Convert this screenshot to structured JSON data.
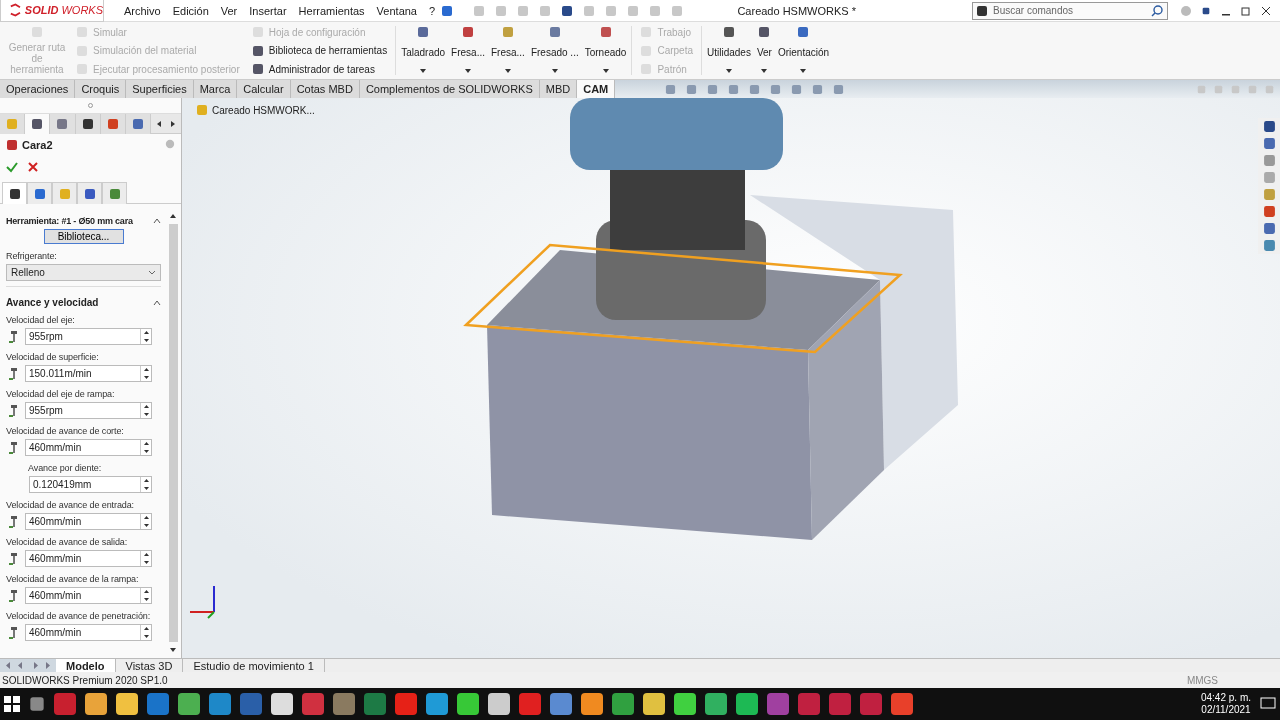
{
  "app": {
    "logo_bold": "SOLID",
    "logo_light": "WORKS",
    "menus": [
      "Archivo",
      "Edición",
      "Ver",
      "Insertar",
      "Herramientas",
      "Ventana",
      "?"
    ],
    "title": "Careado HSMWORKS *",
    "search": {
      "placeholder": "Buscar comandos"
    }
  },
  "ribbon": {
    "generate": {
      "label": "Generar ruta de herramienta",
      "disabled": true
    },
    "column_1": [
      {
        "label": "Simular",
        "disabled": true
      },
      {
        "label": "Simulación del material",
        "disabled": true
      },
      {
        "label": "Ejecutar procesamiento posterior",
        "disabled": true
      }
    ],
    "column_2": [
      {
        "label": "Hoja de configuración",
        "disabled": true
      },
      {
        "label": "Biblioteca de herramientas",
        "disabled": false
      },
      {
        "label": "Administrador de tareas",
        "disabled": false
      }
    ],
    "operations": [
      "Taladrado",
      "Fresa...",
      "Fresa...",
      "Fresado ...",
      "Torneado"
    ],
    "column_3": [
      {
        "label": "Trabajo",
        "disabled": true
      },
      {
        "label": "Carpeta",
        "disabled": true
      },
      {
        "label": "Patrón",
        "disabled": true
      }
    ],
    "utilities": [
      "Utilidades",
      "Ver",
      "Orientación"
    ]
  },
  "command_tabs": [
    {
      "label": "Operaciones",
      "selected": false
    },
    {
      "label": "Croquis",
      "selected": false
    },
    {
      "label": "Superficies",
      "selected": false
    },
    {
      "label": "Marca",
      "selected": false
    },
    {
      "label": "Calcular",
      "selected": false
    },
    {
      "label": "Cotas MBD",
      "selected": false
    },
    {
      "label": "Complementos de SOLIDWORKS",
      "selected": false
    },
    {
      "label": "MBD",
      "selected": false
    },
    {
      "label": "CAM",
      "selected": true
    }
  ],
  "manager_tabs": [
    {
      "selected": false
    },
    {
      "selected": true
    },
    {
      "selected": false
    },
    {
      "selected": false
    },
    {
      "selected": false
    },
    {
      "selected": false
    }
  ],
  "panel": {
    "title": "Cara2",
    "op_tabs": [
      {
        "selected": true
      },
      {
        "selected": false
      },
      {
        "selected": false
      },
      {
        "selected": false
      },
      {
        "selected": false
      }
    ],
    "tool": {
      "heading": "Herramienta: #1 - Ø50 mm cara",
      "button": "Biblioteca...",
      "coolant_label": "Refrigerante:",
      "coolant": "Relleno"
    },
    "feeds_heading": "Avance y velocidad",
    "fields": [
      {
        "label": "Velocidad del eje:",
        "value": "955rpm",
        "kind": "icon"
      },
      {
        "label": "Velocidad de superficie:",
        "value": "150.011m/min",
        "kind": "icon"
      },
      {
        "label": "Velocidad del eje de rampa:",
        "value": "955rpm",
        "kind": "icon"
      },
      {
        "label": "Velocidad de avance de corte:",
        "value": "460mm/min",
        "kind": "icon"
      },
      {
        "label": "Avance por diente:",
        "value": "0.120419mm",
        "kind": "indented"
      },
      {
        "label": "Velocidad de avance de entrada:",
        "value": "460mm/min",
        "kind": "icon"
      },
      {
        "label": "Velocidad de avance de salida:",
        "value": "460mm/min",
        "kind": "icon"
      },
      {
        "label": "Velocidad de avance de la rampa:",
        "value": "460mm/min",
        "kind": "icon"
      },
      {
        "label": "Velocidad de avance de penetración:",
        "value": "460mm/min",
        "kind": "icon"
      }
    ]
  },
  "tree": {
    "item": "Careado HSMWORK..."
  },
  "bottom_tabs": [
    {
      "label": "Modelo",
      "selected": true
    },
    {
      "label": "Vistas 3D",
      "selected": false
    },
    {
      "label": "Estudio de movimiento 1",
      "selected": false
    }
  ],
  "status_bar": {
    "version": "SOLIDWORKS Premium 2020 SP1.0",
    "units": "MMGS"
  },
  "taskbar": {
    "time": "04:42 p. m.",
    "date": "02/11/2021",
    "apps": [
      {
        "color": "#c8202f"
      },
      {
        "color": "#e8a33a"
      },
      {
        "color": "#f0c040"
      },
      {
        "color": "#1a73c8"
      },
      {
        "color": "#4caf50"
      },
      {
        "color": "#1e88c8"
      },
      {
        "color": "#2a5fa8"
      },
      {
        "color": "#dddddd"
      },
      {
        "color": "#d03040"
      },
      {
        "color": "#8a7a60"
      },
      {
        "color": "#1d7a45"
      },
      {
        "color": "#e62117"
      },
      {
        "color": "#1f9ad6"
      },
      {
        "color": "#37c837"
      },
      {
        "color": "#cccccc"
      },
      {
        "color": "#e02020"
      },
      {
        "color": "#5a8ad0"
      },
      {
        "color": "#f08a20"
      },
      {
        "color": "#30a040"
      },
      {
        "color": "#e0c040"
      },
      {
        "color": "#40d040"
      },
      {
        "color": "#30b060"
      },
      {
        "color": "#1db954"
      },
      {
        "color": "#a040a0"
      },
      {
        "color": "#c02040"
      },
      {
        "color": "#c02040"
      },
      {
        "color": "#c02040"
      },
      {
        "color": "#e8402a"
      }
    ]
  }
}
